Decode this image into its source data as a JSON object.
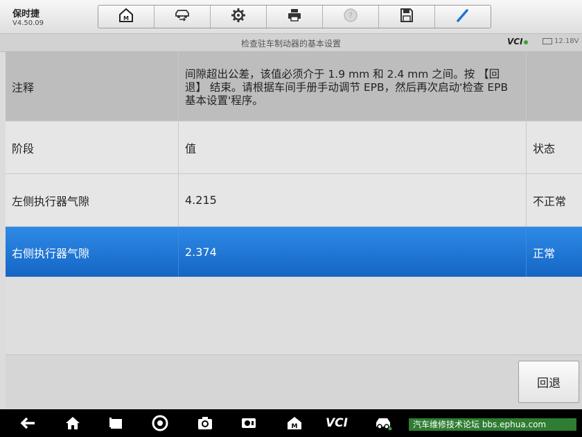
{
  "app": {
    "name": "保时捷",
    "version": "V4.50.09"
  },
  "toolbar": {
    "buttons": [
      {
        "icon": "home-icon"
      },
      {
        "icon": "vehicle-swap-icon"
      },
      {
        "icon": "settings-gear-icon"
      },
      {
        "icon": "print-icon"
      },
      {
        "icon": "help-icon"
      },
      {
        "icon": "save-icon"
      },
      {
        "icon": "pen-icon"
      }
    ]
  },
  "subheader": {
    "title": "检查驻车制动器的基本设置",
    "vci_label": "VCI",
    "voltage": "12.18V"
  },
  "table": {
    "note_label": "注释",
    "note_text": "间隙超出公差，该值必须介于 1.9 mm 和 2.4 mm 之间。按 【回退】 结束。请根据车间手册手动调节 EPB，然后再次启动'检查 EPB 基本设置'程序。",
    "headers": {
      "stage": "阶段",
      "value": "值",
      "status": "状态"
    },
    "rows": [
      {
        "stage": "左侧执行器气隙",
        "value": "4.215",
        "status": "不正常"
      },
      {
        "stage": "右侧执行器气隙",
        "value": "2.374",
        "status": "正常"
      }
    ]
  },
  "actions": {
    "back_label": "回退"
  },
  "navbar": {
    "vci_label": "VCI",
    "watermark": "汽车维修技术论坛 bbs.ephua.com"
  },
  "colors": {
    "selected_row": "#1f74d6",
    "note_bg": "#bdbdbd"
  }
}
